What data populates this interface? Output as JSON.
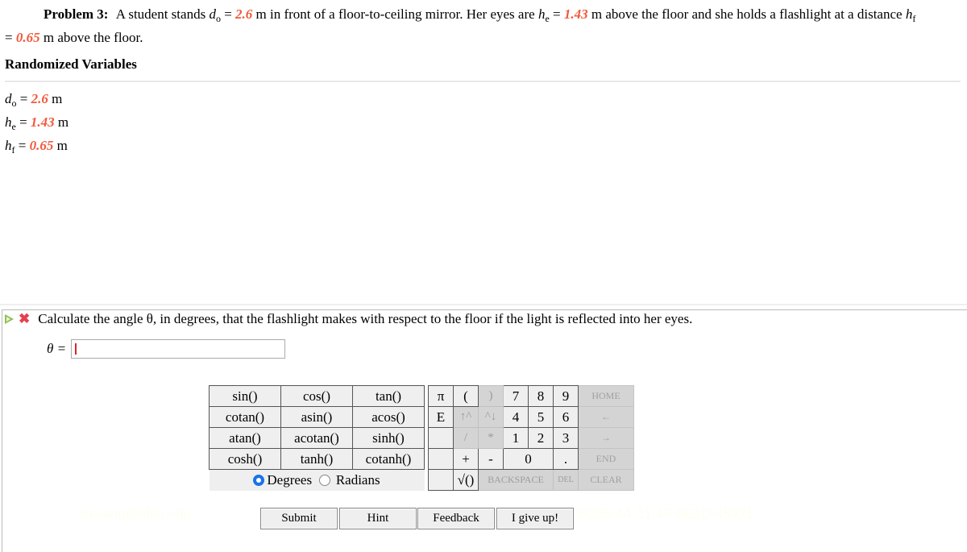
{
  "problem": {
    "label": "Problem 3:",
    "text_1": "A student stands",
    "d_sym": "d",
    "d_sub": "o",
    "d_val": "2.6",
    "text_2": "m in front of a floor-to-ceiling mirror. Her eyes are",
    "he_sym": "h",
    "he_sub": "e",
    "he_val": "1.43",
    "text_3": "m above the floor and she holds a flashlight at a distance",
    "hf_sym": "h",
    "hf_sub": "f",
    "hf_val": "0.65",
    "text_4": "m above the floor."
  },
  "randomized_variables": {
    "title": "Randomized Variables",
    "items": [
      {
        "sym": "d",
        "sub": "o",
        "value": "2.6",
        "unit": "m"
      },
      {
        "sym": "h",
        "sub": "e",
        "value": "1.43",
        "unit": "m"
      },
      {
        "sym": "h",
        "sub": "f",
        "value": "0.65",
        "unit": "m"
      }
    ]
  },
  "part": {
    "question": "Calculate the angle θ, in degrees, that the flashlight makes with respect to the floor if the light is reflected into her eyes.",
    "answer_label": "θ =",
    "answer_value": ""
  },
  "keypad": {
    "functions": [
      [
        "sin()",
        "cos()",
        "tan()"
      ],
      [
        "cotan()",
        "asin()",
        "acos()"
      ],
      [
        "atan()",
        "acotan()",
        "sinh()"
      ],
      [
        "cosh()",
        "tanh()",
        "cotanh()"
      ]
    ],
    "angle_mode": {
      "degrees": "Degrees",
      "radians": "Radians",
      "selected": "Degrees"
    },
    "pi": "π",
    "e": "E",
    "open_paren": "(",
    "close_paren": ")",
    "up_caret": "↑^",
    "caret_down": "^↓",
    "divide": "/",
    "multiply": "*",
    "plus": "+",
    "minus": "-",
    "sqrt": "√()",
    "digits": [
      "7",
      "8",
      "9",
      "4",
      "5",
      "6",
      "1",
      "2",
      "3",
      "0",
      "."
    ],
    "home": "HOME",
    "left": "←",
    "right": "→",
    "end": "END",
    "backspace": "BACKSPACE",
    "del": "DEL",
    "clear": "CLEAR"
  },
  "buttons": {
    "submit": "Submit",
    "hint": "Hint",
    "feedback": "Feedback",
    "give_up": "I give up!"
  },
  "watermarks": {
    "left": "sriwang@sfsu.edu",
    "right": "6C65-4A-31-4F-8E1D-45921"
  },
  "colors": {
    "variable": "#f05a3c",
    "radio_selected": "#1a73e8"
  }
}
